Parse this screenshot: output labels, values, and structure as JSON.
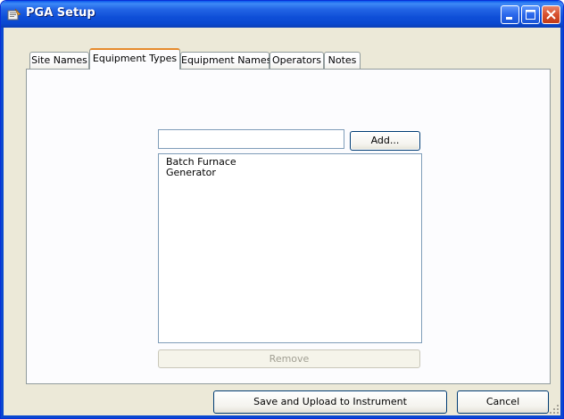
{
  "window": {
    "title": "PGA Setup",
    "controls": [
      "minimize-icon",
      "maximize-icon",
      "close-icon"
    ]
  },
  "tabs": [
    {
      "label": "Site Names",
      "active": false
    },
    {
      "label": "Equipment Types",
      "active": true
    },
    {
      "label": "Equipment Names",
      "active": false
    },
    {
      "label": "Operators",
      "active": false
    },
    {
      "label": "Notes",
      "active": false
    }
  ],
  "equipment_types": {
    "input_value": "",
    "add_label": "Add...",
    "items": [
      "Batch Furnace",
      "Generator"
    ],
    "remove_label": "Remove",
    "remove_enabled": false
  },
  "footer": {
    "save_label": "Save and Upload to Instrument",
    "cancel_label": "Cancel"
  },
  "colors": {
    "title_bar": "#0a48d0",
    "active_tab_accent": "#e68b2c",
    "dialog_background": "#ece9d8"
  }
}
